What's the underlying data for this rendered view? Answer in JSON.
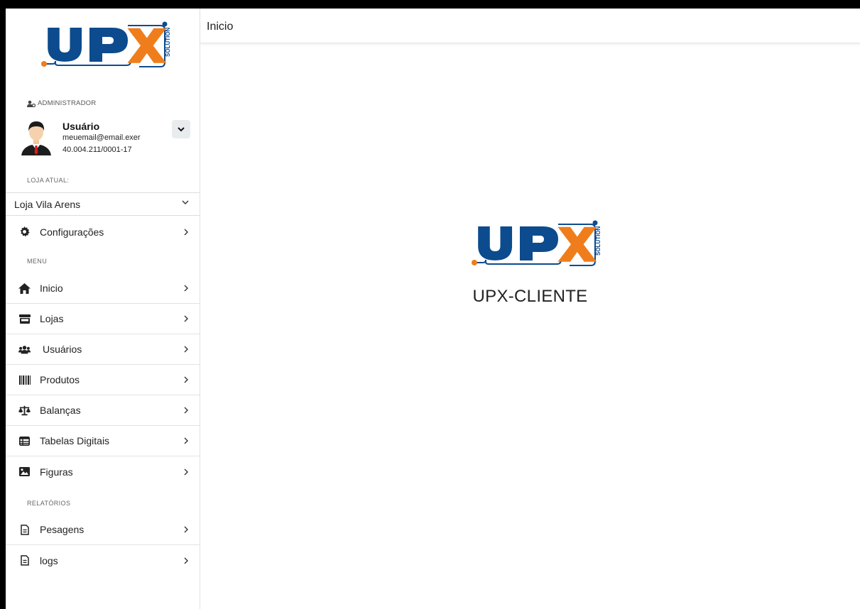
{
  "brand": {
    "logo_text": "UPX",
    "logo_sub": "SOLUTION",
    "colors": {
      "blue": "#0c4b8e",
      "orange": "#f07d1b"
    }
  },
  "user": {
    "role": "ADMINISTRADOR",
    "name": "Usuário",
    "email": "meuemail@email.exer",
    "document": "40.004.211/0001-17"
  },
  "store": {
    "label": "LOJA ATUAL:",
    "selected": "Loja Vila Arens"
  },
  "sidebar": {
    "config_label": "Configurações",
    "menu_label": "MENU",
    "menu_items": [
      {
        "label": "Inicio",
        "icon": "home-icon"
      },
      {
        "label": "Lojas",
        "icon": "store-icon"
      },
      {
        "label": "Usuários",
        "icon": "users-icon"
      },
      {
        "label": "Produtos",
        "icon": "barcode-icon"
      },
      {
        "label": "Balanças",
        "icon": "scale-icon"
      },
      {
        "label": "Tabelas Digitais",
        "icon": "table-icon"
      },
      {
        "label": "Figuras",
        "icon": "image-icon"
      }
    ],
    "reports_label": "RELATÓRIOS",
    "report_items": [
      {
        "label": "Pesagens",
        "icon": "file-icon"
      },
      {
        "label": "logs",
        "icon": "file-icon"
      }
    ]
  },
  "header": {
    "title": "Inicio"
  },
  "main": {
    "app_name": "UPX-CLIENTE"
  }
}
